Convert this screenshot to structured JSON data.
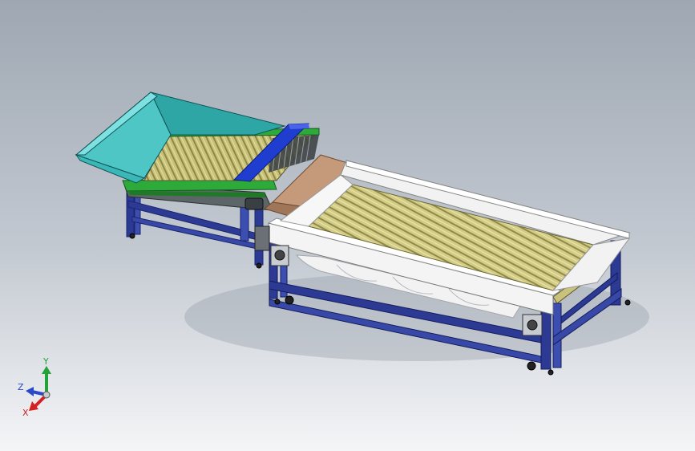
{
  "viewport": {
    "colors": {
      "hopper": "#4fc6c6",
      "rollers": "#c9c27a",
      "frame": "#2c3a93",
      "cover": "#f2f2f2",
      "chute": "#c49a7a",
      "side_rail": "#2eaa3a",
      "blue_bar": "#1f3ed0"
    }
  },
  "triad": {
    "x_label": "X",
    "y_label": "Y",
    "z_label": "Z",
    "colors": {
      "x": "#d42020",
      "y": "#23a23a",
      "z": "#2a48c8"
    }
  }
}
